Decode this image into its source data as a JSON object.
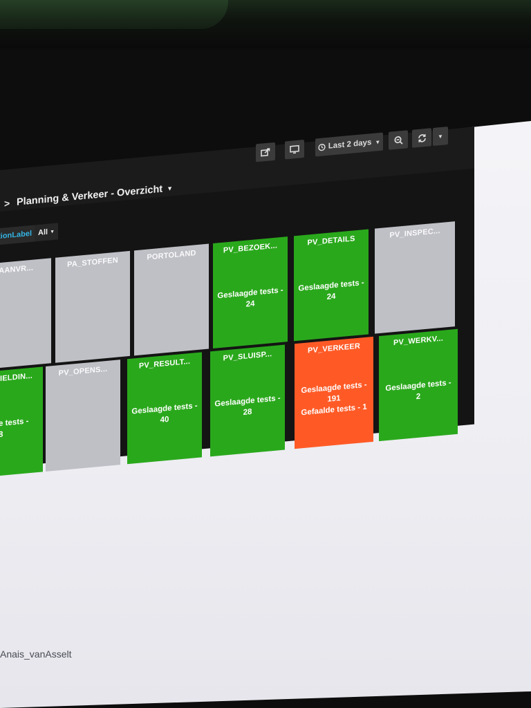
{
  "dashboard": {
    "title": "Planning & Verkeer - Overzicht",
    "toolbar": {
      "share_icon": "share-icon",
      "tv_icon": "monitor-icon",
      "time_range": "Last 2 days",
      "zoom_icon": "zoom-out-icon",
      "refresh_icon": "refresh-icon"
    },
    "variable": {
      "label": "tionLabel",
      "value": "All"
    }
  },
  "colors": {
    "ok": "#2aa81c",
    "fail": "#ff5a26",
    "nodata": "#bfc0c6",
    "link": "#33b5e5"
  },
  "grid": {
    "row1": [
      {
        "name": "_AANVR...",
        "status": "nodata",
        "lines": []
      },
      {
        "name": "PA_STOFFEN",
        "status": "nodata",
        "lines": []
      },
      {
        "name": "PORTOLAND",
        "status": "nodata",
        "lines": []
      },
      {
        "name": "PV_BEZOEK...",
        "status": "ok",
        "lines": [
          "Geslaagde tests -",
          "24"
        ]
      },
      {
        "name": "PV_DETAILS",
        "status": "ok",
        "lines": [
          "Geslaagde tests -",
          "24"
        ]
      },
      {
        "name": "PV_INSPEC...",
        "status": "nodata",
        "lines": []
      }
    ],
    "row2": [
      {
        "name": "IELDIN...",
        "status": "ok",
        "lines": [
          "e tests -",
          "8"
        ]
      },
      {
        "name": "PV_OPENS...",
        "status": "nodata",
        "lines": []
      },
      {
        "name": "PV_RESULT...",
        "status": "ok",
        "lines": [
          "Geslaagde tests -",
          "40"
        ]
      },
      {
        "name": "PV_SLUISP...",
        "status": "ok",
        "lines": [
          "Geslaagde tests -",
          "28"
        ]
      },
      {
        "name": "PV_VERKEER",
        "status": "fail",
        "lines": [
          "Geslaagde tests -",
          "191",
          "Gefaalde tests - 1"
        ]
      },
      {
        "name": "PV_WERKV...",
        "status": "ok",
        "lines": [
          "Geslaagde tests -",
          "2"
        ]
      }
    ]
  },
  "footer": {
    "user": "Anais_vanAsselt"
  }
}
